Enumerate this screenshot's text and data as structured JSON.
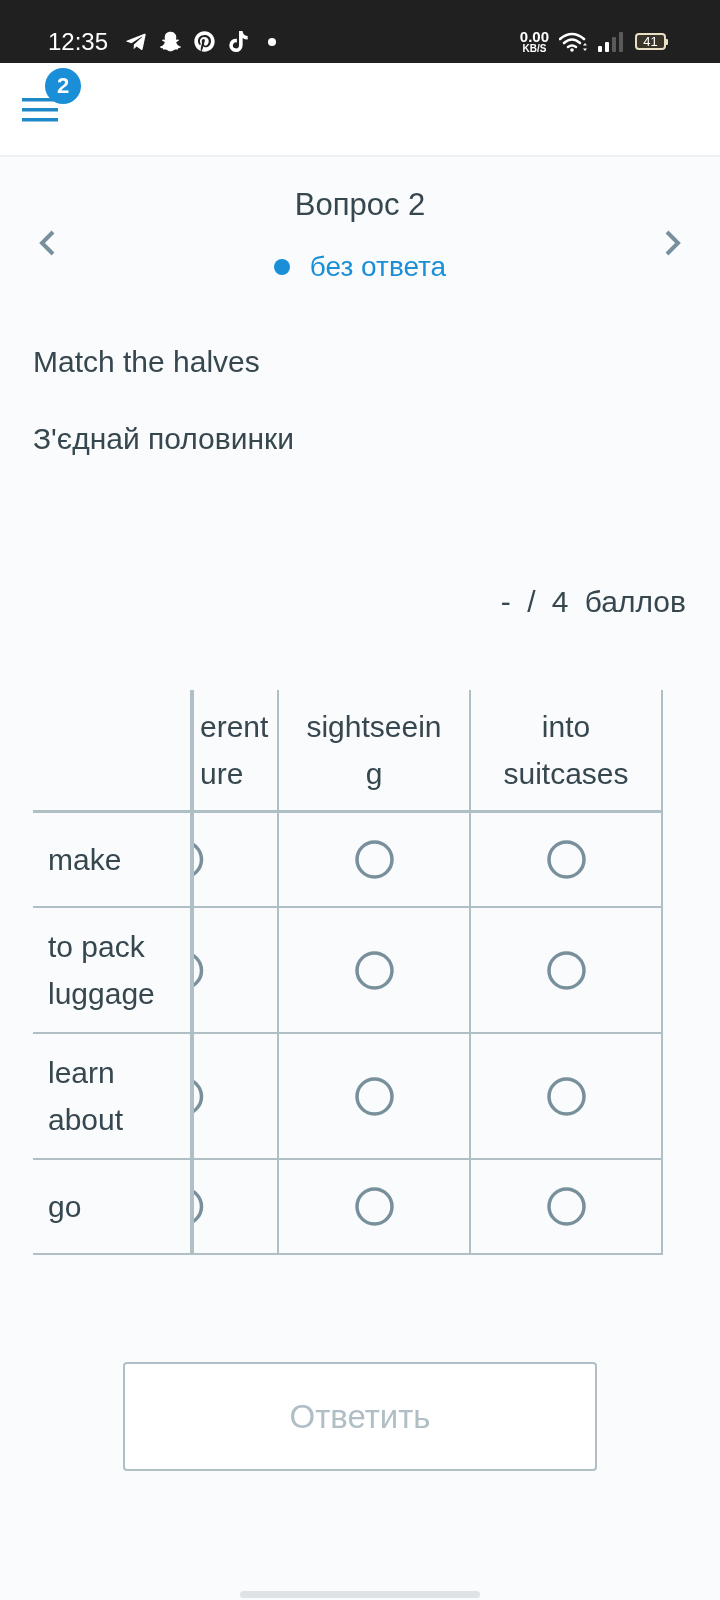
{
  "status_bar": {
    "time": "12:35",
    "speed_value": "0.00",
    "speed_unit": "KB/S",
    "battery": "41"
  },
  "header": {
    "menu_badge": "2"
  },
  "question": {
    "title": "Вопрос 2",
    "status": "без ответа"
  },
  "instructions": [
    "Match the halves",
    "З'єднай половинки"
  ],
  "score": "- / 4 баллов",
  "table": {
    "columns": [
      {
        "kind": "cut",
        "label": "erent ure"
      },
      {
        "kind": "full",
        "label": "sightseeing"
      },
      {
        "kind": "full",
        "label": "into suitcases"
      }
    ],
    "rows": [
      {
        "label": "make",
        "options": [
          {
            "selected": false
          },
          {
            "selected": false
          },
          {
            "selected": false
          }
        ]
      },
      {
        "label": "to pack luggage",
        "options": [
          {
            "selected": false
          },
          {
            "selected": false
          },
          {
            "selected": false
          }
        ]
      },
      {
        "label": "learn about",
        "options": [
          {
            "selected": false
          },
          {
            "selected": false
          },
          {
            "selected": false
          }
        ]
      },
      {
        "label": "go",
        "options": [
          {
            "selected": false
          },
          {
            "selected": false
          },
          {
            "selected": false
          }
        ]
      }
    ]
  },
  "submit_button": {
    "label": "Ответить",
    "disabled": true
  }
}
